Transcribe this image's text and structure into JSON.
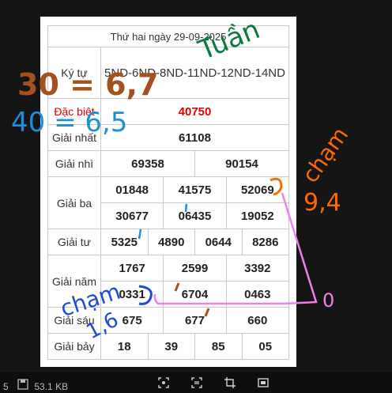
{
  "results": {
    "date_title": "Thứ hai ngày 29-09-2025",
    "kytu_label": "Ký tự",
    "kytu_value": "5ND-6ND-8ND-11ND-12ND-14ND",
    "rows": [
      {
        "label": "Đặc biệt",
        "values": [
          "40750"
        ],
        "highlight": true
      },
      {
        "label": "Giải nhất",
        "values": [
          "61108"
        ]
      },
      {
        "label": "Giải nhì",
        "values": [
          "69358",
          "90154"
        ]
      },
      {
        "label": "Giải ba",
        "values": [
          "01848",
          "41575",
          "52069",
          "30677",
          "06435",
          "19052"
        ]
      },
      {
        "label": "Giải tư",
        "values": [
          "5325",
          "4890",
          "0644",
          "8286"
        ]
      },
      {
        "label": "Giải năm",
        "values": [
          "1767",
          "2599",
          "3392",
          "0331",
          "6704",
          "0463"
        ]
      },
      {
        "label": "Giải sáu",
        "values": [
          "675",
          "677",
          "660"
        ]
      },
      {
        "label": "Giải bảy",
        "values": [
          "18",
          "39",
          "85",
          "05"
        ]
      }
    ]
  },
  "handwriting": {
    "tuan": "Tuần",
    "brown_note": "30 = 6,7",
    "blue_note": "40 = 6,5",
    "orange_top": "chạm",
    "orange_nums": "9,4",
    "blue_bottom": "chạm",
    "blue_nums": "1,6",
    "pink_zero": "0"
  },
  "statusbar": {
    "left_number": "5",
    "file_size": "53.1 KB"
  },
  "colors": {
    "highlight_red": "#e00000",
    "green_ink": "#0a7a3f",
    "brown_ink": "#a5501f",
    "blue_ink": "#1c8fd6",
    "orange_ink": "#ff6a00",
    "pink_ink": "#f07fe8",
    "dark_blue_ink": "#1e4bd8"
  },
  "icons": [
    "save-icon",
    "screenshot-icon",
    "copy-icon",
    "crop-icon",
    "fullscreen-icon"
  ]
}
